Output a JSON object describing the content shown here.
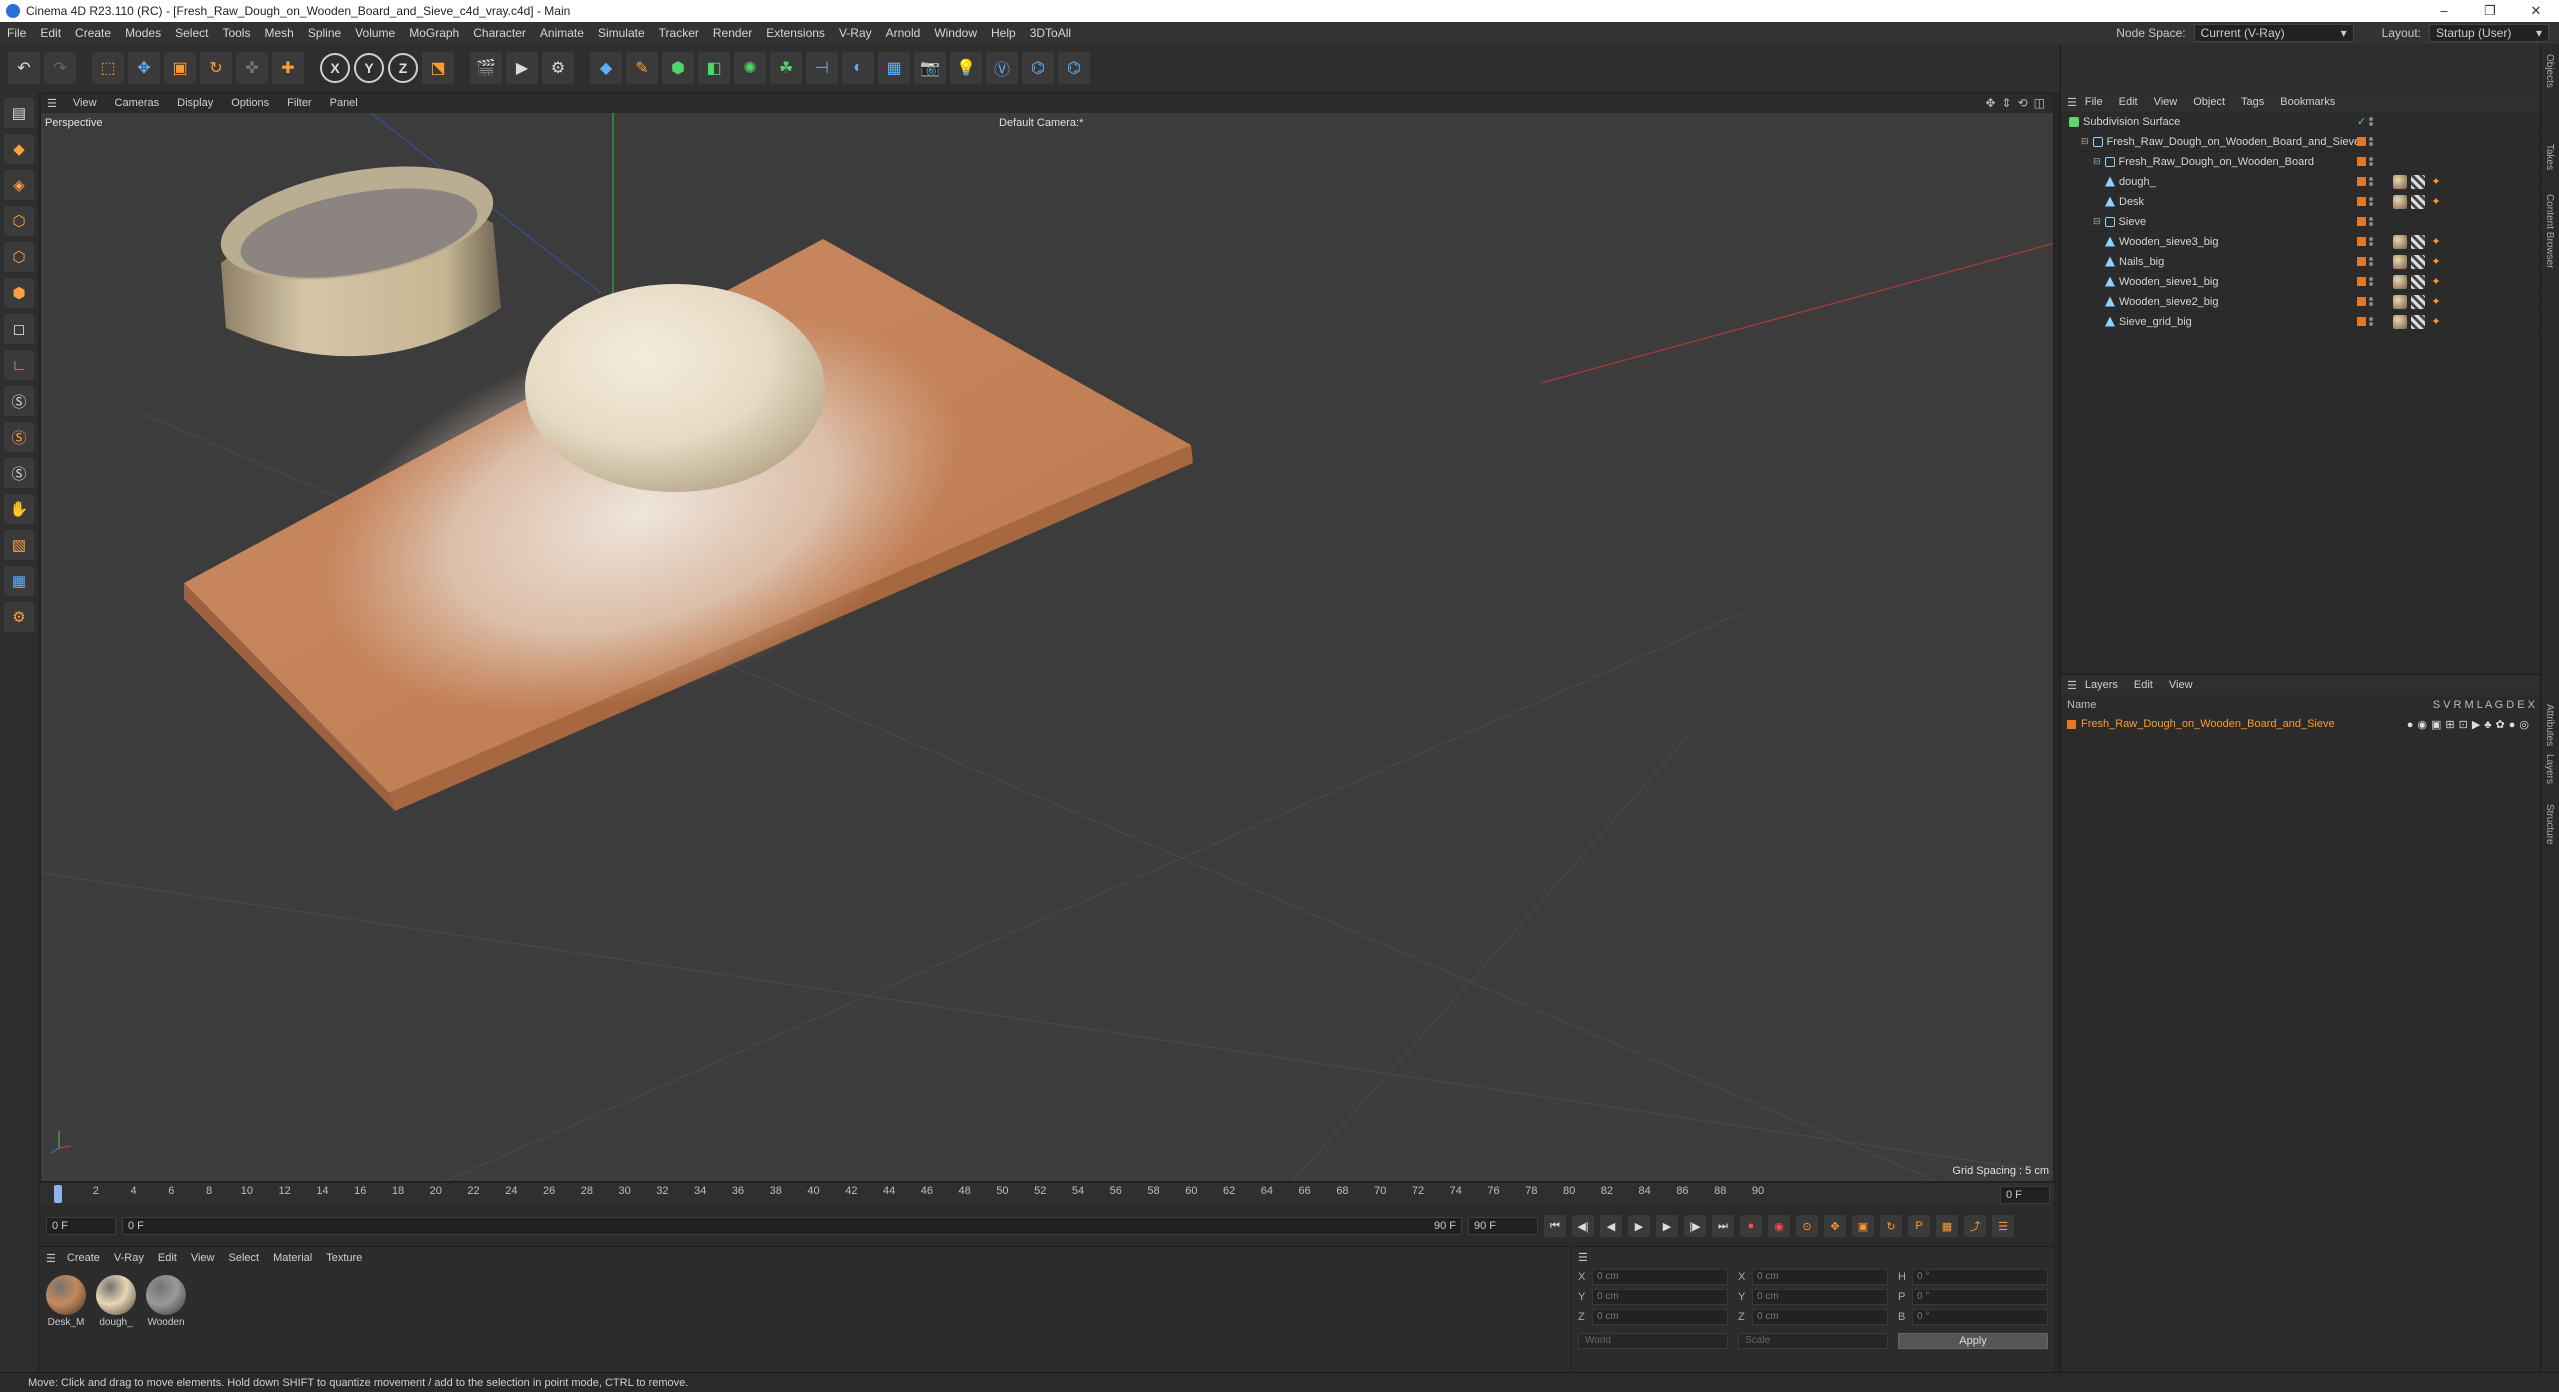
{
  "window": {
    "title": "Cinema 4D R23.110 (RC) - [Fresh_Raw_Dough_on_Wooden_Board_and_Sieve_c4d_vray.c4d] - Main",
    "controls": [
      "–",
      "❐",
      "✕"
    ]
  },
  "menubar": {
    "items": [
      "File",
      "Edit",
      "Create",
      "Modes",
      "Select",
      "Tools",
      "Mesh",
      "Spline",
      "Volume",
      "MoGraph",
      "Character",
      "Animate",
      "Simulate",
      "Tracker",
      "Render",
      "Extensions",
      "V-Ray",
      "Arnold",
      "Window",
      "Help",
      "3DToAll"
    ],
    "node_space_label": "Node Space:",
    "node_space_value": "Current (V-Ray)",
    "layout_label": "Layout:",
    "layout_value": "Startup (User)"
  },
  "toolbar": {
    "axis_x": "X",
    "axis_y": "Y",
    "axis_z": "Z"
  },
  "viewport": {
    "menu": [
      "View",
      "Cameras",
      "Display",
      "Options",
      "Filter",
      "Panel"
    ],
    "projection": "Perspective",
    "camera": "Default Camera:*",
    "grid_spacing": "Grid Spacing : 5 cm"
  },
  "timeline": {
    "ticks": [
      "0",
      "2",
      "4",
      "6",
      "8",
      "10",
      "12",
      "14",
      "16",
      "18",
      "20",
      "22",
      "24",
      "26",
      "28",
      "30",
      "32",
      "34",
      "36",
      "38",
      "40",
      "42",
      "44",
      "46",
      "48",
      "50",
      "52",
      "54",
      "56",
      "58",
      "60",
      "62",
      "64",
      "66",
      "68",
      "70",
      "72",
      "74",
      "76",
      "78",
      "80",
      "82",
      "84",
      "86",
      "88",
      "90"
    ],
    "current_frame_right": "0 F"
  },
  "playbar": {
    "start": "0 F",
    "preview_start": "0 F",
    "preview_end": "90 F",
    "end": "90 F"
  },
  "material_manager": {
    "menu": [
      "Create",
      "V-Ray",
      "Edit",
      "View",
      "Select",
      "Material",
      "Texture"
    ],
    "materials": [
      {
        "label": "Desk_M",
        "color": "#c68a5a"
      },
      {
        "label": "dough_",
        "color": "#e8d6b4"
      },
      {
        "label": "Wooden",
        "color": "#9a9a9a"
      }
    ]
  },
  "coordinates": {
    "rows": [
      [
        {
          "axis": "X",
          "value": "0 cm"
        },
        {
          "axis": "X",
          "value": "0 cm"
        },
        {
          "axis": "H",
          "value": "0 °"
        }
      ],
      [
        {
          "axis": "Y",
          "value": "0 cm"
        },
        {
          "axis": "Y",
          "value": "0 cm"
        },
        {
          "axis": "P",
          "value": "0 °"
        }
      ],
      [
        {
          "axis": "Z",
          "value": "0 cm"
        },
        {
          "axis": "Z",
          "value": "0 cm"
        },
        {
          "axis": "B",
          "value": "0 °"
        }
      ]
    ],
    "mode": "World",
    "size_mode": "Scale",
    "apply_label": "Apply"
  },
  "object_manager": {
    "menu": [
      "File",
      "Edit",
      "View",
      "Object",
      "Tags",
      "Bookmarks"
    ],
    "objects": [
      {
        "name": "Subdivision Surface",
        "indent": 0,
        "type": "sub",
        "tags": 0
      },
      {
        "name": "Fresh_Raw_Dough_on_Wooden_Board_and_Sieve",
        "indent": 1,
        "type": "null",
        "tags": 0
      },
      {
        "name": "Fresh_Raw_Dough_on_Wooden_Board",
        "indent": 2,
        "type": "null",
        "tags": 0
      },
      {
        "name": "dough_",
        "indent": 3,
        "type": "poly",
        "tags": 3
      },
      {
        "name": "Desk",
        "indent": 3,
        "type": "poly",
        "tags": 3
      },
      {
        "name": "Sieve",
        "indent": 2,
        "type": "null",
        "tags": 0
      },
      {
        "name": "Wooden_sieve3_big",
        "indent": 3,
        "type": "poly",
        "tags": 3
      },
      {
        "name": "Nails_big",
        "indent": 3,
        "type": "poly",
        "tags": 3
      },
      {
        "name": "Wooden_sieve1_big",
        "indent": 3,
        "type": "poly",
        "tags": 3
      },
      {
        "name": "Wooden_sieve2_big",
        "indent": 3,
        "type": "poly",
        "tags": 3
      },
      {
        "name": "Sieve_grid_big",
        "indent": 3,
        "type": "poly",
        "tags": 3
      }
    ]
  },
  "layer_manager": {
    "menu": [
      "Layers",
      "Edit",
      "View"
    ],
    "header_name": "Name",
    "header_flags": "S V R M L A G D E X",
    "layers": [
      {
        "name": "Fresh_Raw_Dough_on_Wooden_Board_and_Sieve",
        "color": "#e07a2a"
      }
    ]
  },
  "side_tabs": [
    "Objects",
    "Takes",
    "Content Browser",
    "Attributes",
    "Layers",
    "Structure"
  ],
  "status": {
    "message": "Move: Click and drag to move elements. Hold down SHIFT to quantize movement / add to the selection in point mode, CTRL to remove."
  }
}
